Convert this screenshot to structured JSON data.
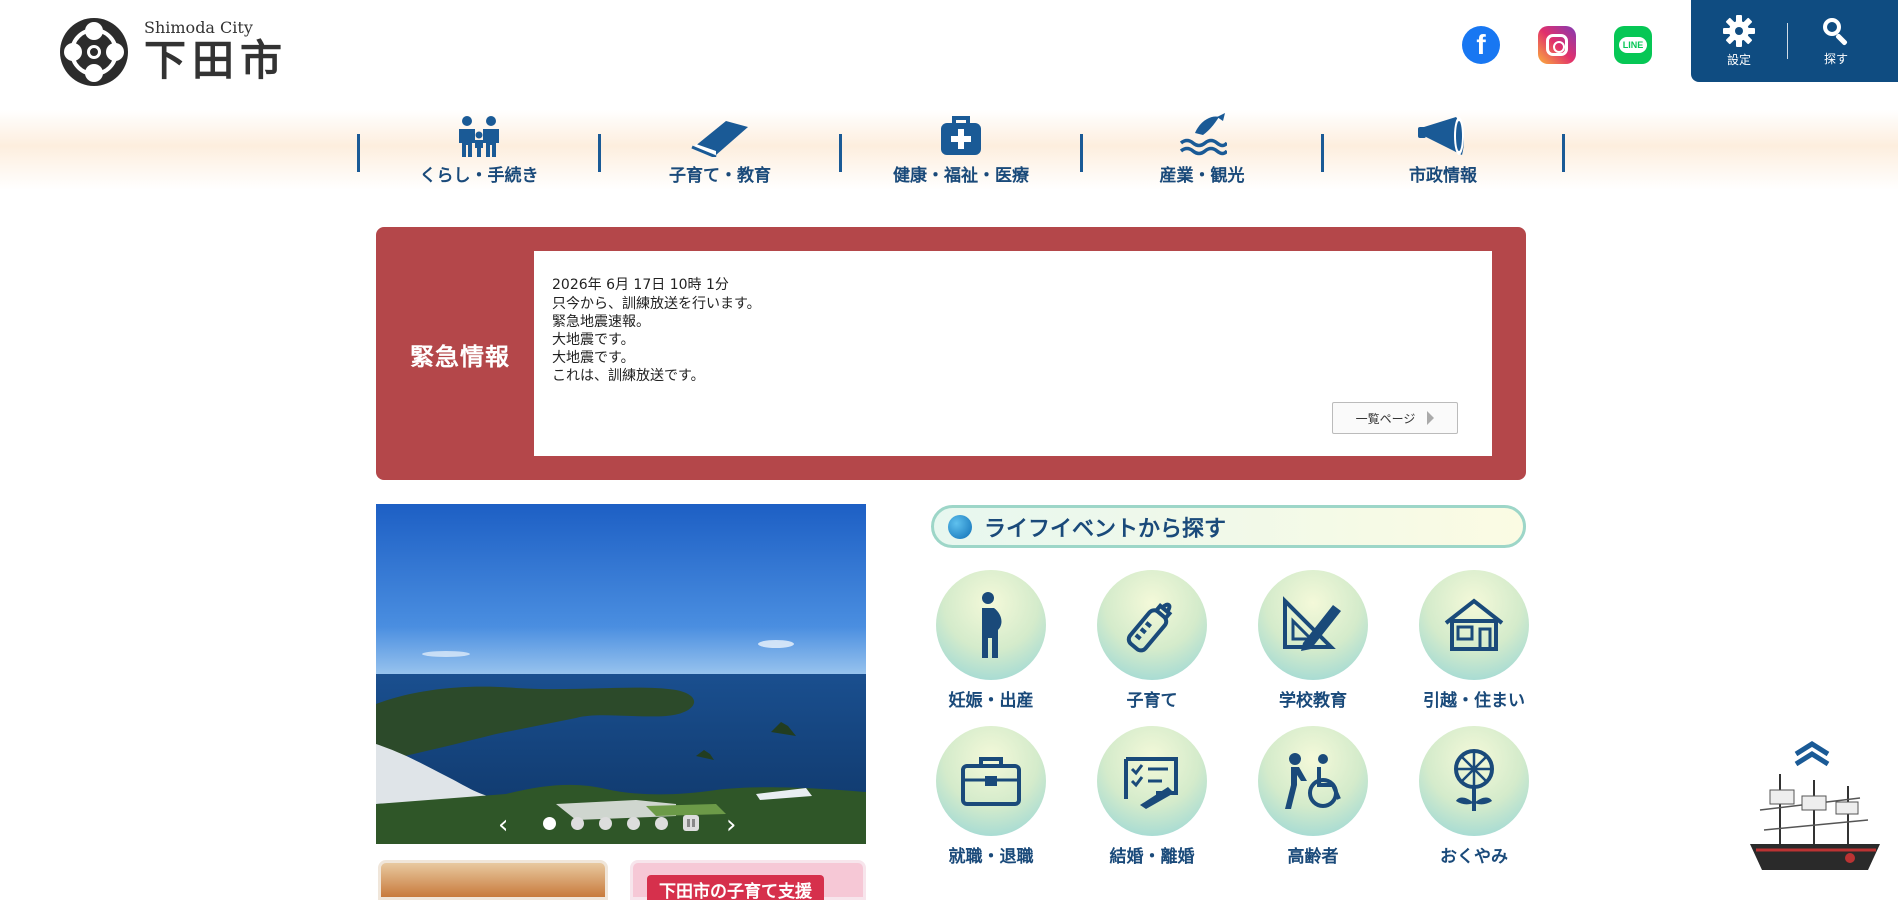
{
  "header": {
    "logo_en": "Shimoda City",
    "logo_jp": "下田市"
  },
  "social": {
    "facebook": "f",
    "line": "LINE"
  },
  "tools": {
    "settings_label": "設定",
    "search_label": "探す"
  },
  "nav": [
    {
      "label": "くらし・手続き",
      "icon": "family-icon"
    },
    {
      "label": "子育て・教育",
      "icon": "book-icon"
    },
    {
      "label": "健康・福祉・医療",
      "icon": "medical-bag-icon"
    },
    {
      "label": "産業・観光",
      "icon": "fish-wave-icon"
    },
    {
      "label": "市政情報",
      "icon": "megaphone-icon"
    }
  ],
  "emergency": {
    "title": "緊急情報",
    "date": "2026年 6月 17日 10時 1分",
    "lines": [
      "只今から、訓練放送を行います。",
      "緊急地震速報。",
      "大地震です。",
      "大地震です。",
      "これは、訓練放送です。"
    ],
    "more_label": "一覧ページ"
  },
  "slideshow": {
    "prev": "‹",
    "next": "›",
    "dot_count": 5,
    "active_dot": 1
  },
  "banners": {
    "childcare_label": "下田市の子育て支援"
  },
  "life_events": {
    "title": "ライフイベントから探す",
    "items": [
      {
        "label": "妊娠・出産",
        "icon": "pregnancy-icon"
      },
      {
        "label": "子育て",
        "icon": "baby-bottle-icon"
      },
      {
        "label": "学校教育",
        "icon": "ruler-pencil-icon"
      },
      {
        "label": "引越・住まい",
        "icon": "house-icon"
      },
      {
        "label": "就職・退職",
        "icon": "briefcase-icon"
      },
      {
        "label": "結婚・離婚",
        "icon": "certificate-icon"
      },
      {
        "label": "高齢者",
        "icon": "wheelchair-icon"
      },
      {
        "label": "おくやみ",
        "icon": "chrysanthemum-icon"
      }
    ]
  },
  "colors": {
    "brand_blue": "#0f4c81",
    "emergency_red": "#b4474a",
    "nav_text": "#1a4a7a"
  }
}
